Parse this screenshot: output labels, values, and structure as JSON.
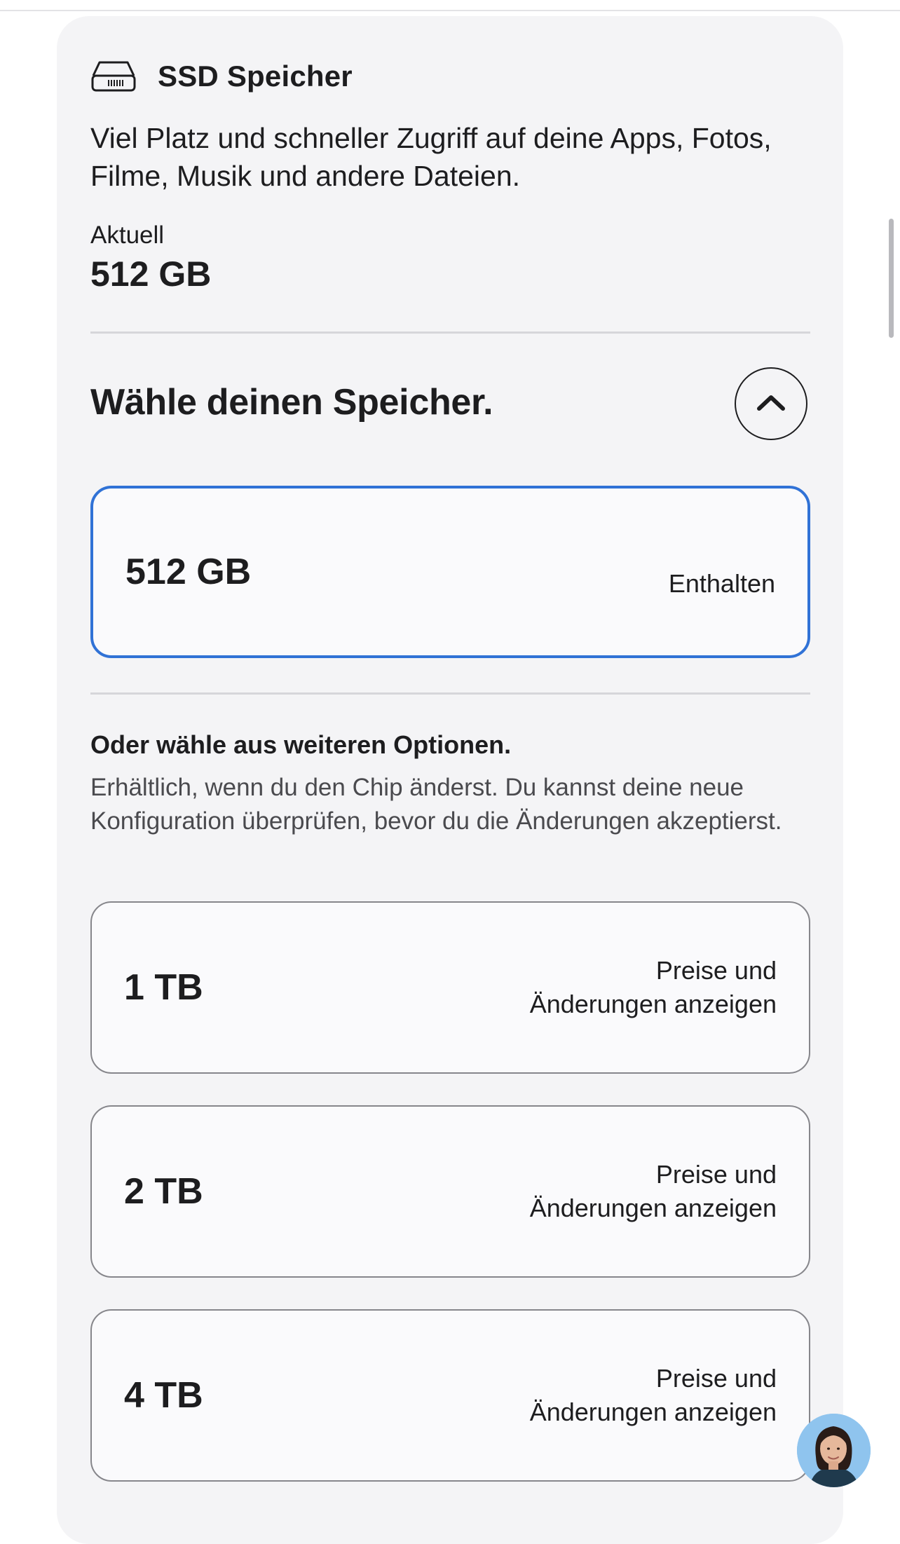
{
  "header": {
    "icon": "ssd-drive-icon",
    "title": "SSD Speicher"
  },
  "description": "Viel Platz und schneller Zugriff auf deine Apps, Fotos, Filme, Musik und andere Dateien.",
  "current": {
    "label": "Aktuell",
    "value": "512 GB"
  },
  "choose": {
    "title": "Wähle deinen Speicher.",
    "toggle_icon": "chevron-up-icon"
  },
  "selected_option": {
    "size": "512 GB",
    "note": "Enthalten"
  },
  "more_options": {
    "title": "Oder wähle aus weiteren Optionen.",
    "description": "Erhältlich, wenn du den Chip änderst. Du kannst deine neue Konfiguration überprüfen, bevor du die Änderungen akzeptierst.",
    "items": [
      {
        "size": "1 TB",
        "note": "Preise und\nÄnderungen anzeigen"
      },
      {
        "size": "2 TB",
        "note": "Preise und\nÄnderungen anzeigen"
      },
      {
        "size": "4 TB",
        "note": "Preise und\nÄnderungen anzeigen"
      }
    ]
  },
  "chat_avatar": "support-agent-avatar",
  "colors": {
    "selected_border": "#3072d6",
    "panel_bg": "#f4f4f6"
  }
}
